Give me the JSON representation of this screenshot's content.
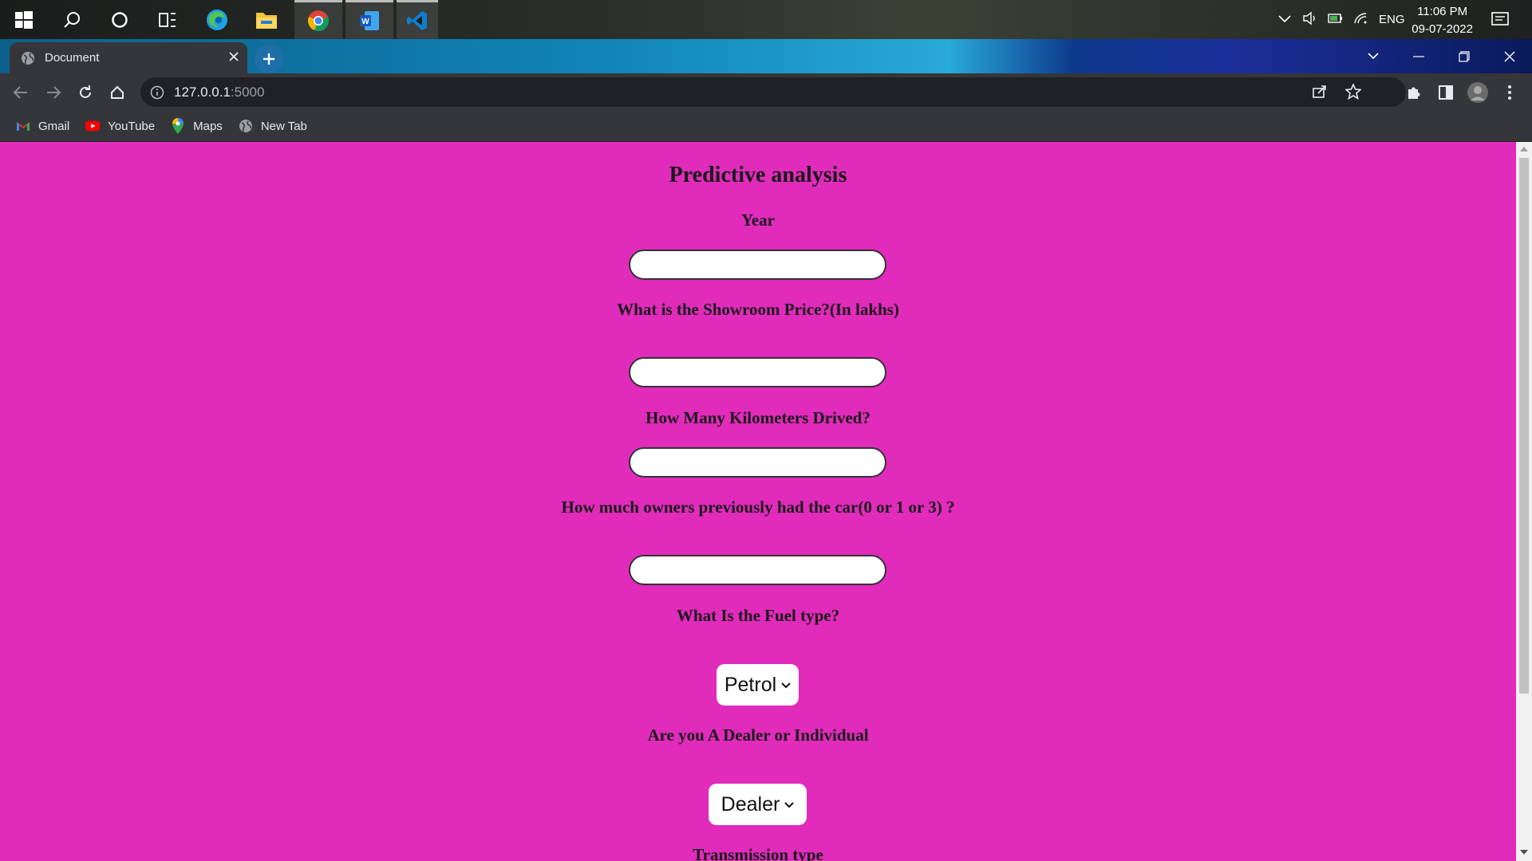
{
  "taskbar": {
    "icons": [
      "windows-start-icon",
      "search-icon",
      "cortana-icon",
      "task-view-icon",
      "edge-icon",
      "file-explorer-icon",
      "chrome-icon",
      "word-icon",
      "vscode-icon"
    ],
    "tray_language": "ENG",
    "time": "11:06 PM",
    "date": "09-07-2022"
  },
  "browser": {
    "tab_title": "Document",
    "url_host": "127.0.0.1",
    "url_port": ":5000",
    "bookmarks": [
      {
        "label": "Gmail",
        "icon": "gmail-icon"
      },
      {
        "label": "YouTube",
        "icon": "youtube-icon"
      },
      {
        "label": "Maps",
        "icon": "maps-icon"
      },
      {
        "label": "New Tab",
        "icon": "globe-icon"
      }
    ]
  },
  "page": {
    "background": "#e02bbb",
    "title": "Predictive analysis",
    "year_label": "Year",
    "year_value": "",
    "price_label": "What is the Showroom Price?(In lakhs)",
    "price_value": "",
    "km_label": "How Many Kilometers Drived?",
    "km_value": "",
    "owners_label": "How much owners previously had the car(0 or 1 or 3) ?",
    "owners_value": "",
    "fuel_label": "What Is the Fuel type?",
    "fuel_selected": "Petrol",
    "seller_label": "Are you A Dealer or Individual",
    "seller_selected": "Dealer",
    "transmission_label": "Transmission type"
  }
}
